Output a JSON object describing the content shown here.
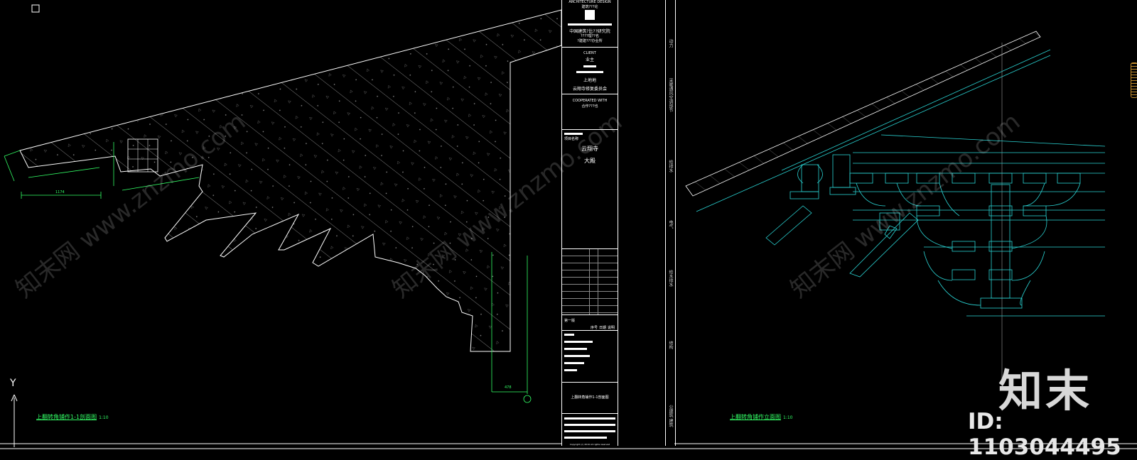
{
  "colors": {
    "background": "#000000",
    "line": "#ffffff",
    "cyan": "#2ad4d4",
    "green": "#33ff66"
  },
  "left_view": {
    "title": "上翻转角铺作1-1剖面图",
    "scale": "1:10",
    "dim_label": "1174",
    "dim_label_2": "478",
    "axis_y": "Y"
  },
  "right_view": {
    "title": "上翻转角铺作立面图",
    "scale": "1:10"
  },
  "title_block": {
    "architecture_design": "ARCHITECTURE DESIGN",
    "arch_sub": "建筑???论",
    "institute": "中国建筑?比??研究院",
    "inst_line2": "????理??名",
    "inst_line3": "?建建???办业所",
    "client_label": "CLIENT",
    "client_value": "业主",
    "client_line": "上地地",
    "client_org": "云翔寺修复委员会",
    "cooperated_label": "COOPERATED WITH",
    "cooperated_value": "合作???也",
    "project_label": "项目名称",
    "project_name": "云翔寺",
    "project_sub": "大殿",
    "drawing_title": "上翻转角铺作1-1剖面图",
    "table_head": "第一版",
    "table_cols": [
      "序号",
      "日期",
      "说明"
    ],
    "copyright": "Copyright (c) 2019 All rights reserved"
  },
  "side_tabs": [
    "动力",
    "采暖通风空调部节",
    "给排水",
    "电气",
    "给水排水",
    "结构",
    "公建筑 建筑"
  ],
  "watermark": {
    "brand": "知末",
    "id_text": "ID: 1103044495",
    "diag_1": "知末网 www.znzmo.com",
    "diag_2": "知末网 www.znzmo.com",
    "diag_3": "知末网 www.znzmo.com"
  }
}
